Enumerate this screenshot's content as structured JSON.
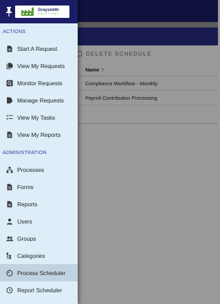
{
  "background": {
    "toolbar": {
      "delete_schedule_label": "DELETE SCHEDULE"
    },
    "table": {
      "header": {
        "name_label": "Name",
        "sort_glyph": "↑"
      },
      "rows": [
        "Compliance Workflow - Monthly",
        "Payroll Contribution Processing"
      ]
    }
  },
  "drawer": {
    "logo": {
      "name": "Graysmith",
      "tagline": "SOLUTIONS"
    },
    "sections": {
      "actions": "ACTIONS",
      "administration": "ADMINISTRATION"
    },
    "actions_items": [
      {
        "label": "Start A Request",
        "icon": "file-add-icon"
      },
      {
        "label": "View My Requests",
        "icon": "file-copy-icon"
      },
      {
        "label": "Monitor Requests",
        "icon": "monitor-search-icon"
      },
      {
        "label": "Manage Requests",
        "icon": "edit-doc-icon"
      },
      {
        "label": "View My Tasks",
        "icon": "task-list-icon"
      },
      {
        "label": "View My Reports",
        "icon": "report-doc-icon"
      }
    ],
    "admin_items": [
      {
        "label": "Processes",
        "icon": "hierarchy-icon"
      },
      {
        "label": "Forms",
        "icon": "form-doc-icon"
      },
      {
        "label": "Reports",
        "icon": "report-doc-icon"
      },
      {
        "label": "Users",
        "icon": "user-icon"
      },
      {
        "label": "Groups",
        "icon": "group-icon"
      },
      {
        "label": "Categories",
        "icon": "tree-icon"
      },
      {
        "label": "Process Scheduler",
        "icon": "timer-icon",
        "active": true
      },
      {
        "label": "Report Scheduler",
        "icon": "history-icon"
      }
    ]
  },
  "colors": {
    "header_navy": "#1b1d66",
    "drawer_bg": "#ddeef9",
    "section_label": "#2a3f9c",
    "active_item_bg": "#c1d2e0"
  }
}
